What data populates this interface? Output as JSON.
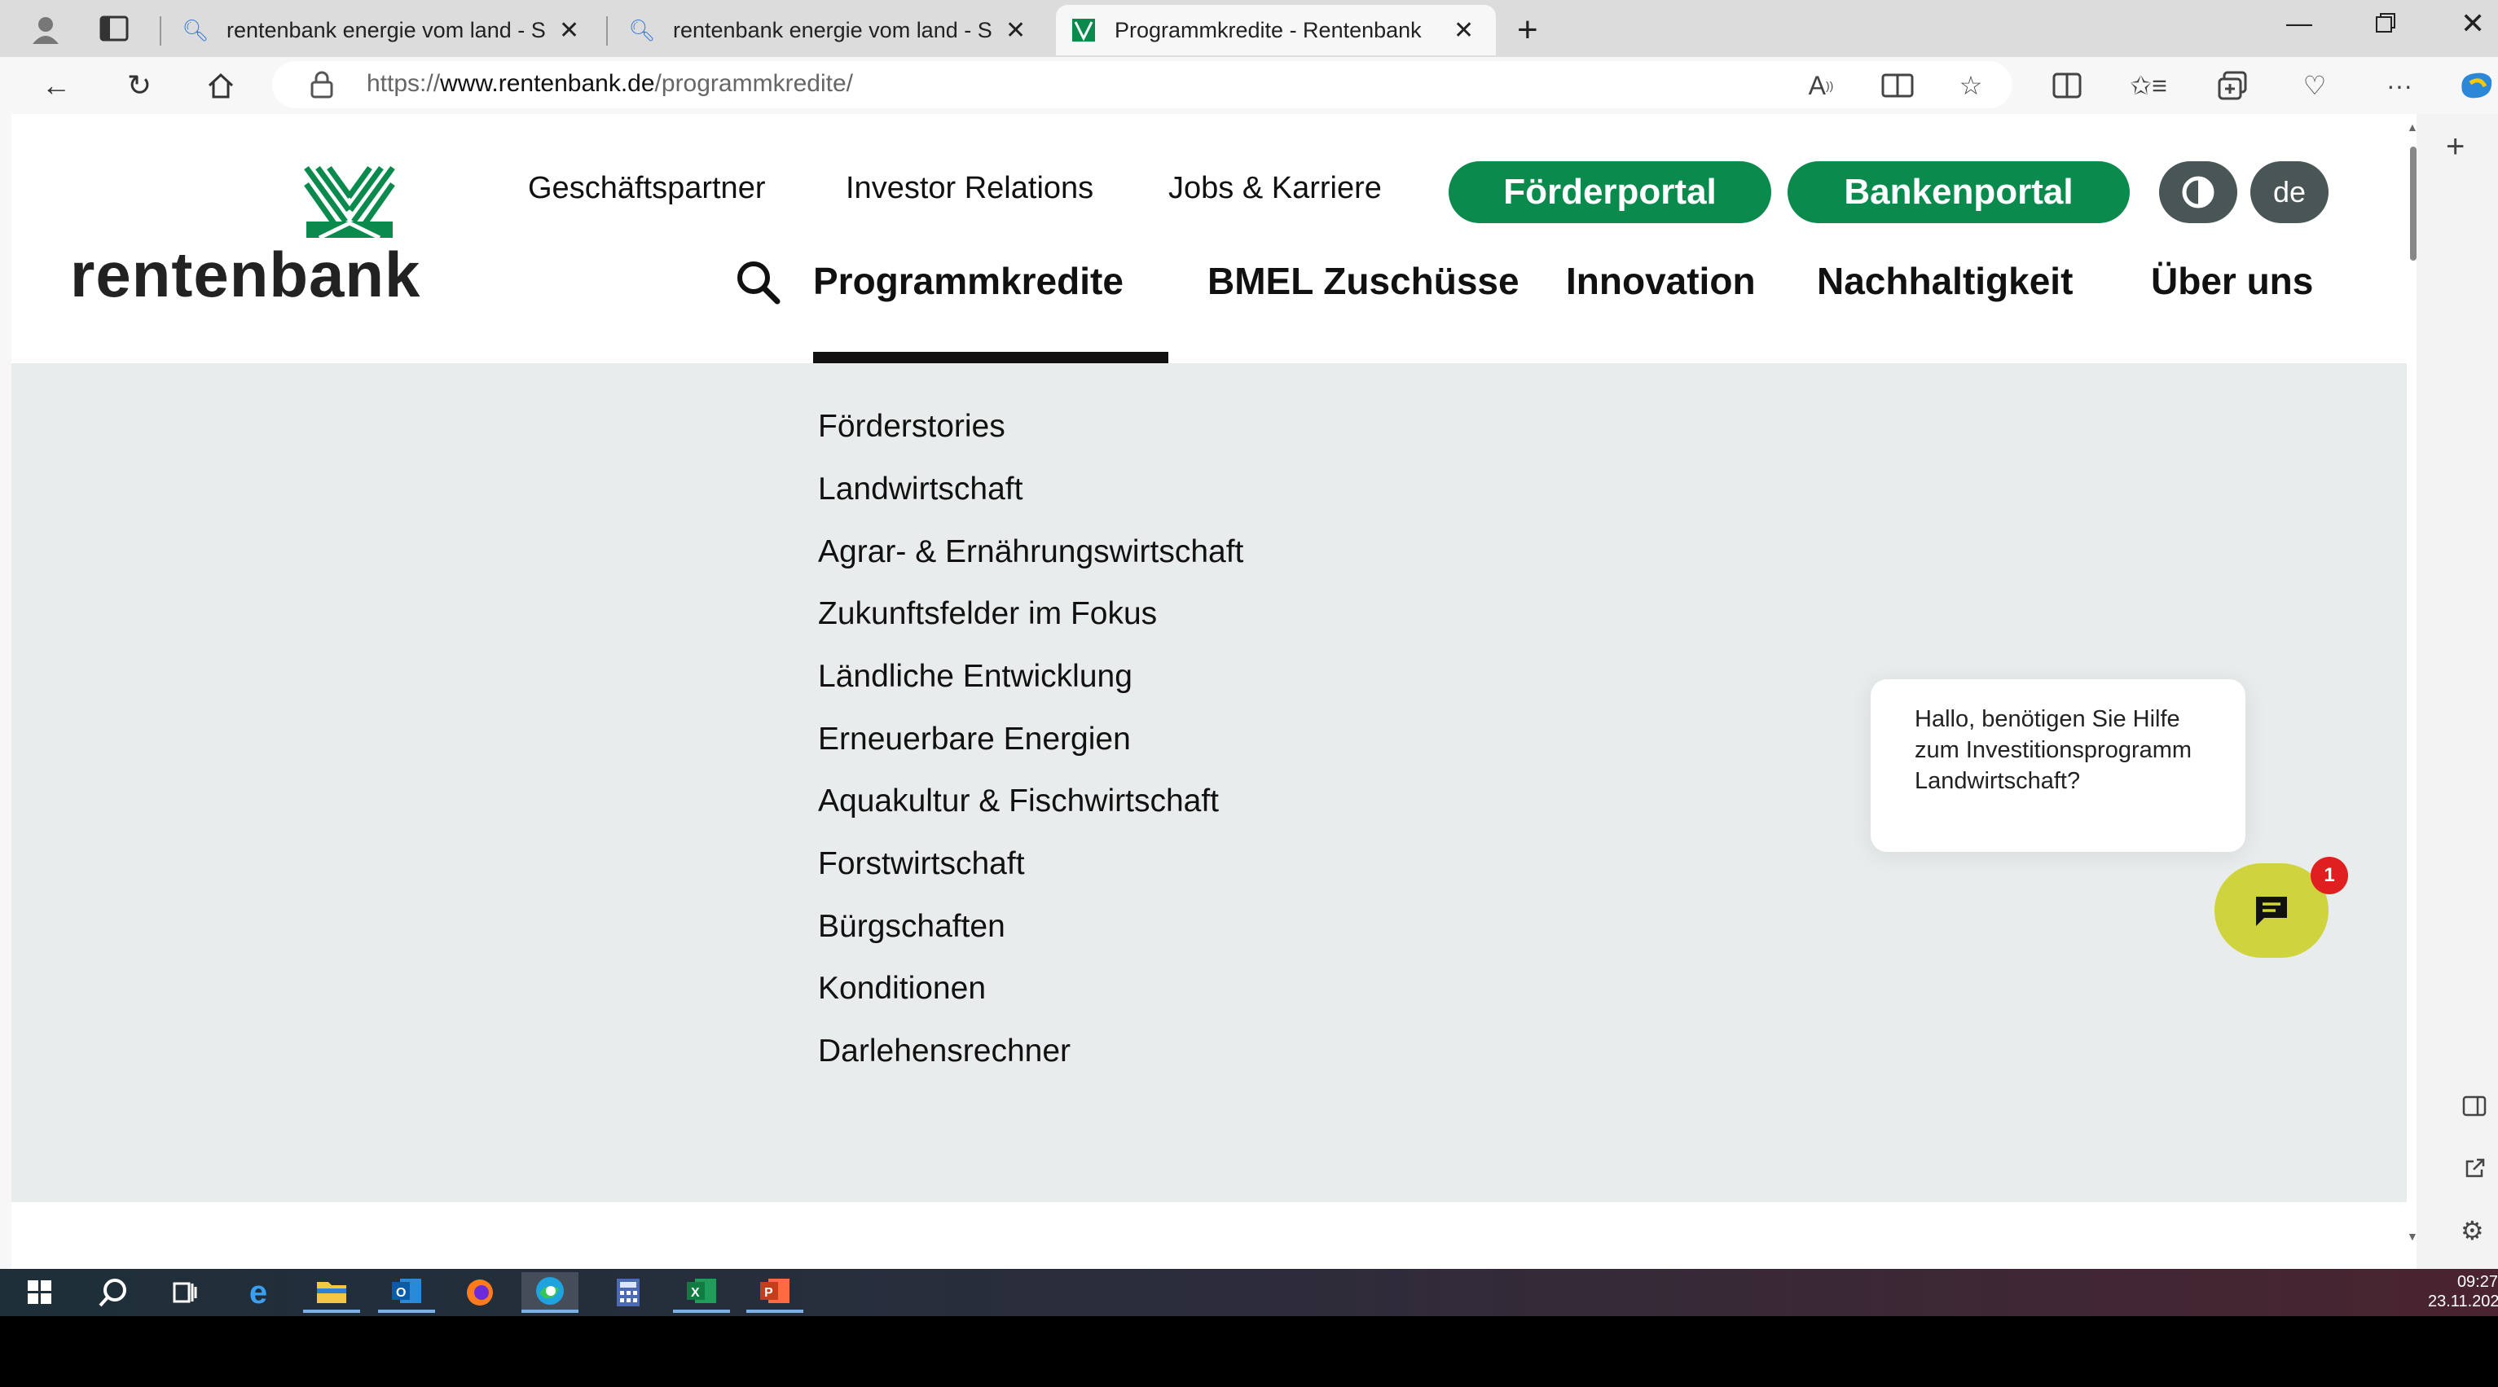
{
  "browser": {
    "tabs": [
      {
        "label": "rentenbank energie vom land - S",
        "icon": "search-icon"
      },
      {
        "label": "rentenbank energie vom land - S",
        "icon": "search-icon"
      },
      {
        "label": "Programmkredite - Rentenbank",
        "icon": "rentenbank-favicon",
        "active": true
      }
    ],
    "new_tab": "+",
    "url_prefix": "https://",
    "url_domain": "www.rentenbank.de",
    "url_path": "/programmkredite/"
  },
  "site": {
    "logo_text": "rentenbank",
    "brand_color": "#0a8a4d",
    "top_links": [
      "Geschäftspartner",
      "Investor Relations",
      "Jobs & Karriere"
    ],
    "portal_buttons": [
      "Förderportal",
      "Bankenportal"
    ],
    "language": "de",
    "main_nav": [
      "Programmkredite",
      "BMEL Zuschüsse",
      "Innovation",
      "Nachhaltigkeit",
      "Über uns"
    ],
    "active_nav": "Programmkredite",
    "submenu": [
      "Förderstories",
      "Landwirtschaft",
      "Agrar- & Ernährungswirtschaft",
      "Zukunftsfelder im Fokus",
      "Ländliche Entwicklung",
      "Erneuerbare Energien",
      "Aquakultur & Fischwirtschaft",
      "Forstwirtschaft",
      "Bürgschaften",
      "Konditionen",
      "Darlehensrechner"
    ]
  },
  "chat": {
    "message": "Hallo, benötigen Sie Hilfe zum Investitionsprogramm Landwirtschaft?",
    "badge_count": "1",
    "button_color": "#cfd33d"
  },
  "taskbar": {
    "time": "09:27",
    "date": "23.11.202"
  }
}
